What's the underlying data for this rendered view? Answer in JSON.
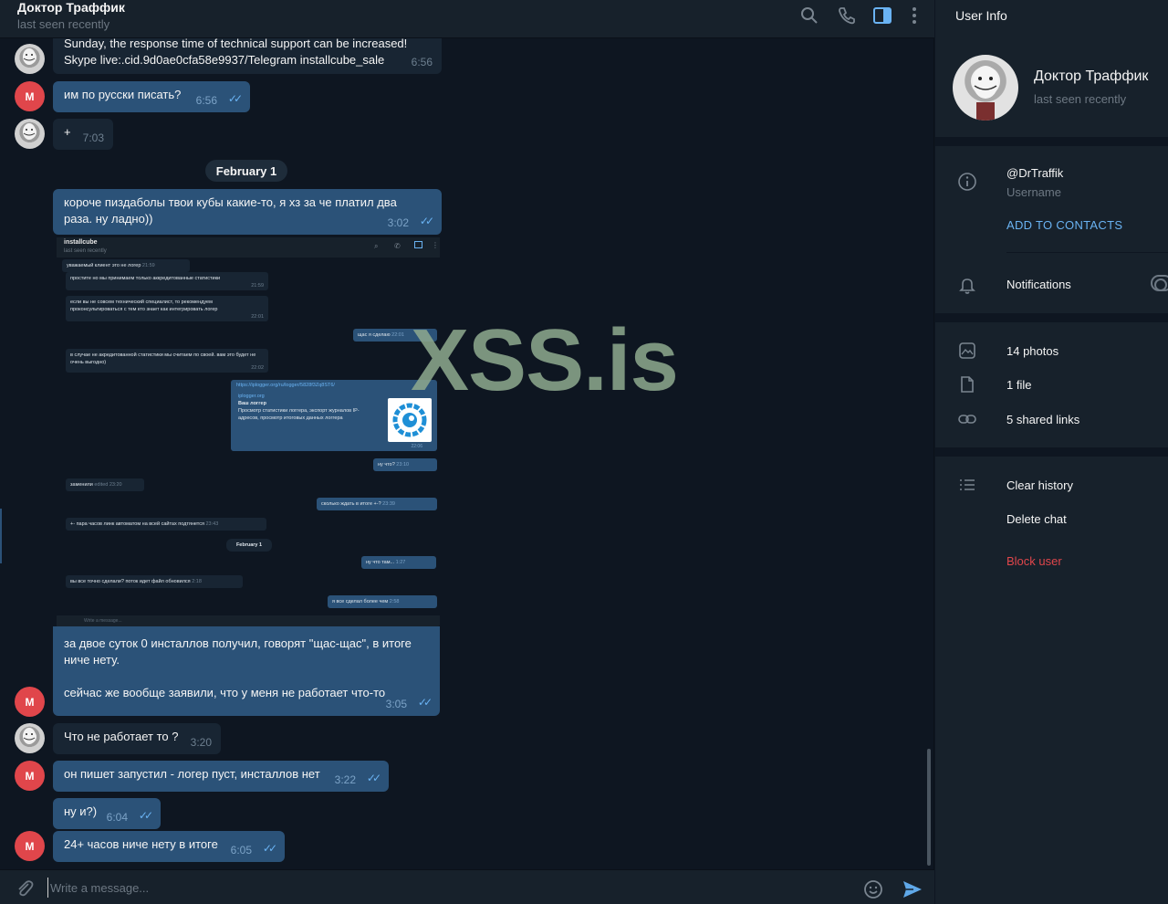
{
  "chat": {
    "title": "Доктор Траффик",
    "status": "last seen recently",
    "header_icons": [
      "search-icon",
      "phone-icon",
      "sidebar-toggle-icon",
      "more-icon"
    ]
  },
  "messages": [
    {
      "from": "DrTraffik",
      "text": "Sunday, the response time of technical support can be increased!\nSkype live:.cid.9d0ae0cfa58e9937/Telegram installcube_sale",
      "time": "6:56"
    },
    {
      "from": "M",
      "text": "им по русски писать?",
      "time": "6:56",
      "read": true
    },
    {
      "from": "DrTraffik",
      "text": "+",
      "time": "7:03"
    },
    {
      "date": "February 1"
    },
    {
      "from": "M",
      "text": "короче пиздаболы твои кубы какие-то, я хз за че платил два раза. ну ладно))",
      "time": "3:02",
      "read": true
    },
    {
      "from": "M",
      "text": "за двое суток 0 инсталлов получил, говорят \"щас-щас\", в итоге ниче нету.",
      "text2": "сейчас же вообще заявили, что у меня не работает что-то",
      "time": "3:05",
      "read": true
    },
    {
      "from": "DrTraffik",
      "text": "Что не работает то ?",
      "time": "3:20"
    },
    {
      "from": "M",
      "text": "он пишет запустил - логер пуст, инсталлов нет",
      "time": "3:22",
      "read": true
    },
    {
      "from": "M",
      "text": "ну и?)",
      "time": "6:04",
      "read": true
    },
    {
      "from": "M",
      "text": "24+ часов ниче нету в итоге",
      "time": "6:05",
      "read": true
    }
  ],
  "avatar_letter": "M",
  "embedded_screenshot": {
    "title": "installcube",
    "status": "last seen recently",
    "messages": [
      {
        "text": "уважаемый клиент это не логер",
        "time": "21:59"
      },
      {
        "text": "простите но мы принимаем только аккредитованные статистики",
        "time": "21:59"
      },
      {
        "text": "если вы не совсем технический специалист, то рекомендуем проконсультироваться с тем кто знает как интегрировать логер",
        "time": "22:01"
      },
      {
        "text": "щас я сделаю",
        "time": "22:01",
        "out": true
      },
      {
        "text": "в случае не акредитованной статистики мы считаем по своей. вам это будет не очень выгодно)",
        "time": "22:02"
      },
      {
        "link": "https://iplogger.org/ru/logger/5828f3Zq8ST6/",
        "site": "iplogger.org",
        "card_title": "Ваш логгер",
        "card_text": "Просмотр статистики логгера, экспорт журналов IP-адресов, просмотр итоговых данных логгера",
        "time": "22:06",
        "out": true
      },
      {
        "text": "ну что?",
        "time": "23:10",
        "out": true
      },
      {
        "text": "заменили",
        "time": "edited 23:20"
      },
      {
        "text": "сколько ждать в итоге +-?",
        "time": "23:39",
        "out": true
      },
      {
        "text": "+- пара часов линк автоматом на всей сайтах подтянется",
        "time": "23:43"
      },
      {
        "date": "February 1"
      },
      {
        "text": "ну что там...",
        "time": "1:27",
        "out": true
      },
      {
        "text": "вы все точно сделали? поток идет файл обновился",
        "time": "2:18"
      },
      {
        "text": "я все сделал более чем",
        "time": "2:58",
        "out": true
      }
    ],
    "input_placeholder": "Write a message..."
  },
  "watermark": "XSS.is",
  "composer": {
    "placeholder": "Write a message..."
  },
  "user_info": {
    "title": "User Info",
    "name": "Доктор Траффик",
    "status": "last seen recently",
    "username": "@DrTraffik",
    "username_label": "Username",
    "add_contacts": "ADD TO CONTACTS",
    "notifications": "Notifications",
    "photos": "14 photos",
    "files": "1 file",
    "links": "5 shared links",
    "clear_history": "Clear history",
    "delete_chat": "Delete chat",
    "block_user": "Block user"
  },
  "colors": {
    "bg": "#0e1621",
    "panel": "#17212b",
    "incoming": "#182533",
    "outgoing": "#2b5278",
    "accent": "#6ab3f3",
    "danger": "#e0464b"
  }
}
